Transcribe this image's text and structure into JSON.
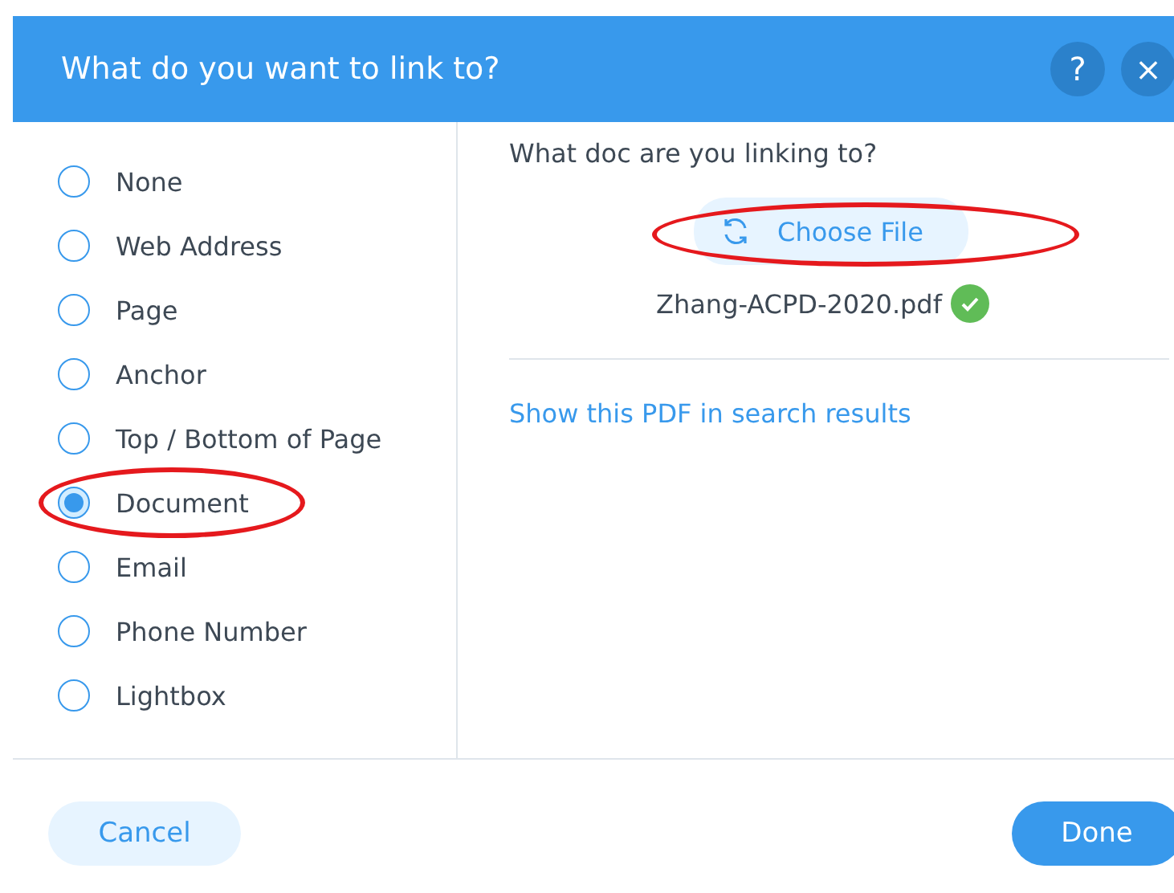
{
  "dialog": {
    "title": "What do you want to link to?",
    "help": "?",
    "close": "×"
  },
  "link_types": [
    {
      "label": "None",
      "selected": false,
      "circled": false
    },
    {
      "label": "Web Address",
      "selected": false,
      "circled": false
    },
    {
      "label": "Page",
      "selected": false,
      "circled": false
    },
    {
      "label": "Anchor",
      "selected": false,
      "circled": false
    },
    {
      "label": "Top / Bottom of Page",
      "selected": false,
      "circled": false
    },
    {
      "label": "Document",
      "selected": true,
      "circled": true
    },
    {
      "label": "Email",
      "selected": false,
      "circled": false
    },
    {
      "label": "Phone Number",
      "selected": false,
      "circled": false
    },
    {
      "label": "Lightbox",
      "selected": false,
      "circled": false
    }
  ],
  "document": {
    "prompt": "What doc are you linking to?",
    "choose_button": {
      "label": "Choose File",
      "circled": true
    },
    "file_name": "Zhang-ACPD-2020.pdf",
    "uploaded": true,
    "seo_link": "Show this PDF in search results"
  },
  "buttons": {
    "cancel": "Cancel",
    "done": "Done"
  }
}
